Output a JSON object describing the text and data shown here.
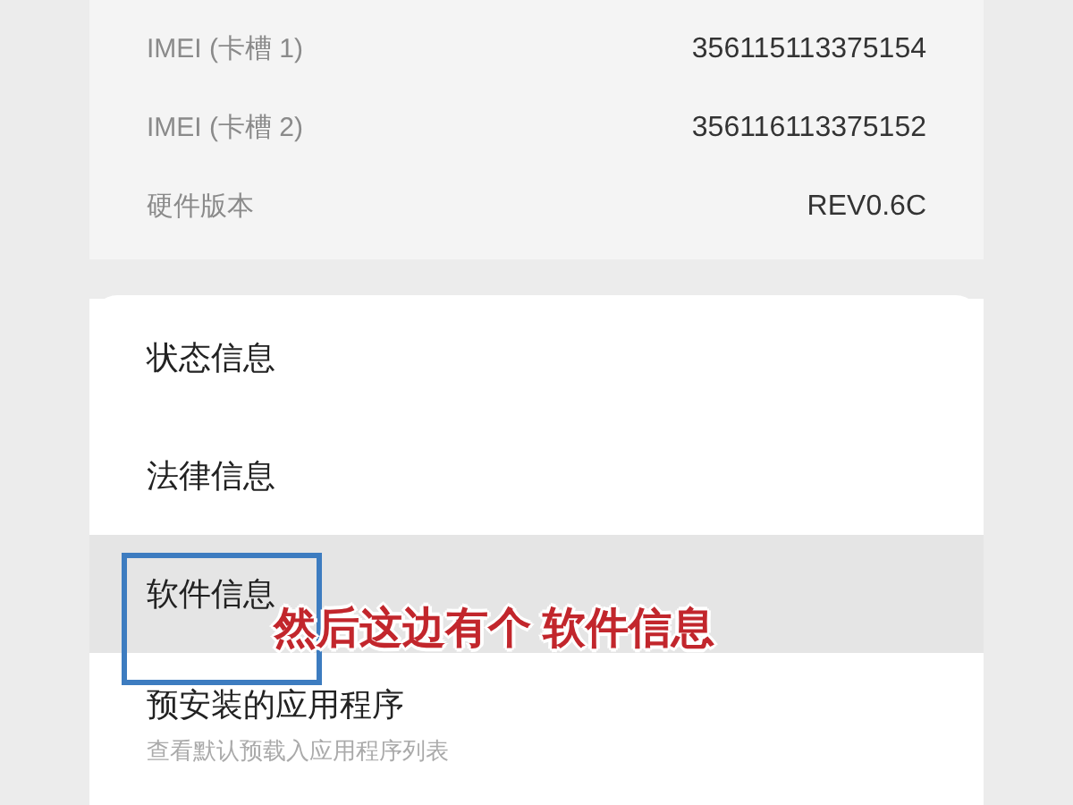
{
  "device_info": [
    {
      "label": "IMEI (卡槽 1)",
      "value": "356115113375154"
    },
    {
      "label": "IMEI (卡槽 2)",
      "value": "356116113375152"
    },
    {
      "label": "硬件版本",
      "value": "REV0.6C"
    }
  ],
  "menu": [
    {
      "title": "状态信息",
      "selected": false
    },
    {
      "title": "法律信息",
      "selected": false
    },
    {
      "title": "软件信息",
      "selected": true,
      "highlighted": true
    },
    {
      "title": "预安装的应用程序",
      "subtitle": "查看默认预载入应用程序列表",
      "selected": false
    }
  ],
  "caption": "然后这边有个 软件信息"
}
